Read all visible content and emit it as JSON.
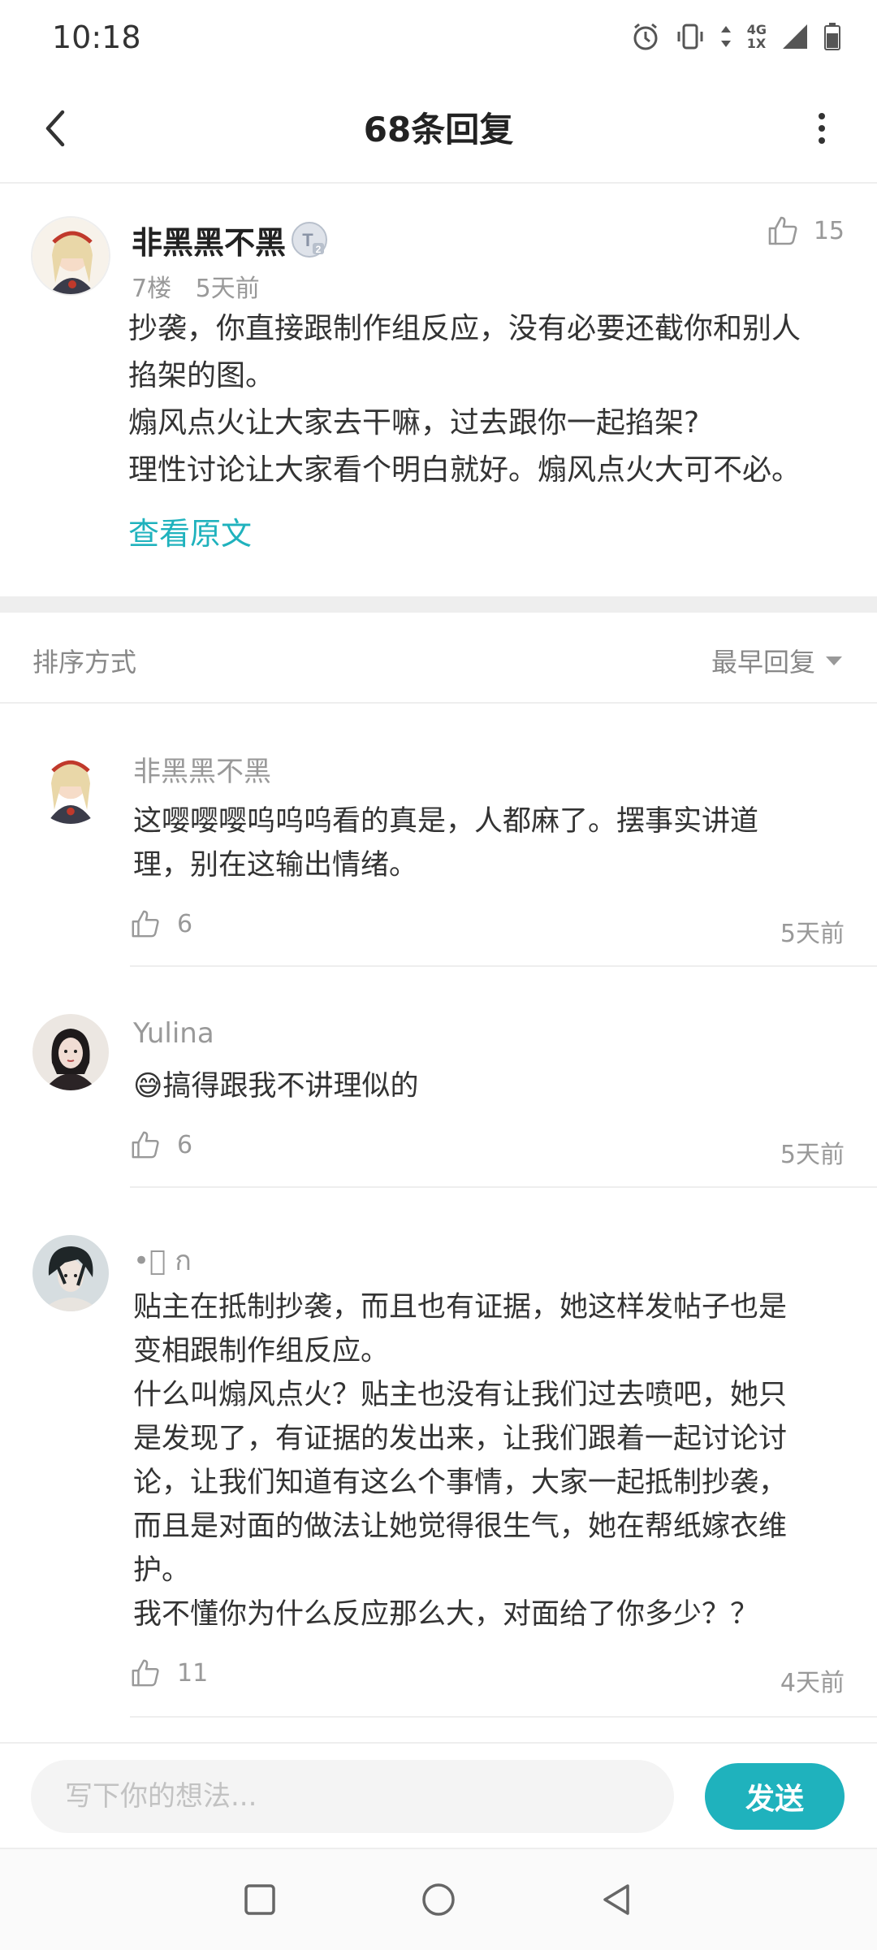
{
  "status_bar": {
    "time": "10:18",
    "network_top": "4G",
    "network_bottom": "1X",
    "icons": [
      "alarm-icon",
      "vibrate-icon",
      "data-arrows-icon",
      "signal-icon",
      "battery-icon"
    ]
  },
  "header": {
    "title": "68条回复",
    "back_icon": "chevron-left-icon",
    "more_icon": "more-vertical-icon"
  },
  "main_comment": {
    "author": "非黑黑不黑",
    "badge": "T2",
    "floor": "7楼",
    "time": "5天前",
    "likes": "15",
    "lines": [
      "抄袭，你直接跟制作组反应，没有必要还截你和别人",
      "掐架的图。",
      "煽风点火让大家去干嘛，过去跟你一起掐架?",
      "理性讨论让大家看个明白就好。煽风点火大可不必。"
    ],
    "view_original": "查看原文"
  },
  "sort": {
    "label": "排序方式",
    "selected": "最早回复"
  },
  "replies": [
    {
      "author": "非黑黑不黑",
      "lines": [
        "这嘤嘤嘤呜呜呜看的真是，人都麻了。摆事实讲道",
        "理，别在这输出情绪。"
      ],
      "likes": "6",
      "time": "5天前"
    },
    {
      "author": "Yulina",
      "emoji": "😅",
      "lines": [
        "搞得跟我不讲理似的"
      ],
      "likes": "6",
      "time": "5天前"
    },
    {
      "author": "•ᷫ ก",
      "lines": [
        "贴主在抵制抄袭，而且也有证据，她这样发帖子也是",
        "变相跟制作组反应。",
        "什么叫煽风点火？贴主也没有让我们过去喷吧，她只",
        "是发现了，有证据的发出来，让我们跟着一起讨论讨",
        "论，让我们知道有这么个事情，大家一起抵制抄袭，",
        "而且是对面的做法让她觉得很生气，她在帮纸嫁衣维",
        "护。",
        "我不懂你为什么反应那么大，对面给了你多少？？"
      ],
      "likes": "11",
      "time": "4天前"
    }
  ],
  "input_bar": {
    "placeholder": "写下你的想法...",
    "send_label": "发送"
  },
  "colors": {
    "accent": "#1fb2bd",
    "text_primary": "#222222",
    "text_secondary": "#999999",
    "divider": "#eeeeee"
  },
  "nav_bar": {
    "icons": [
      "recent-apps-icon",
      "home-icon",
      "back-triangle-icon"
    ]
  }
}
